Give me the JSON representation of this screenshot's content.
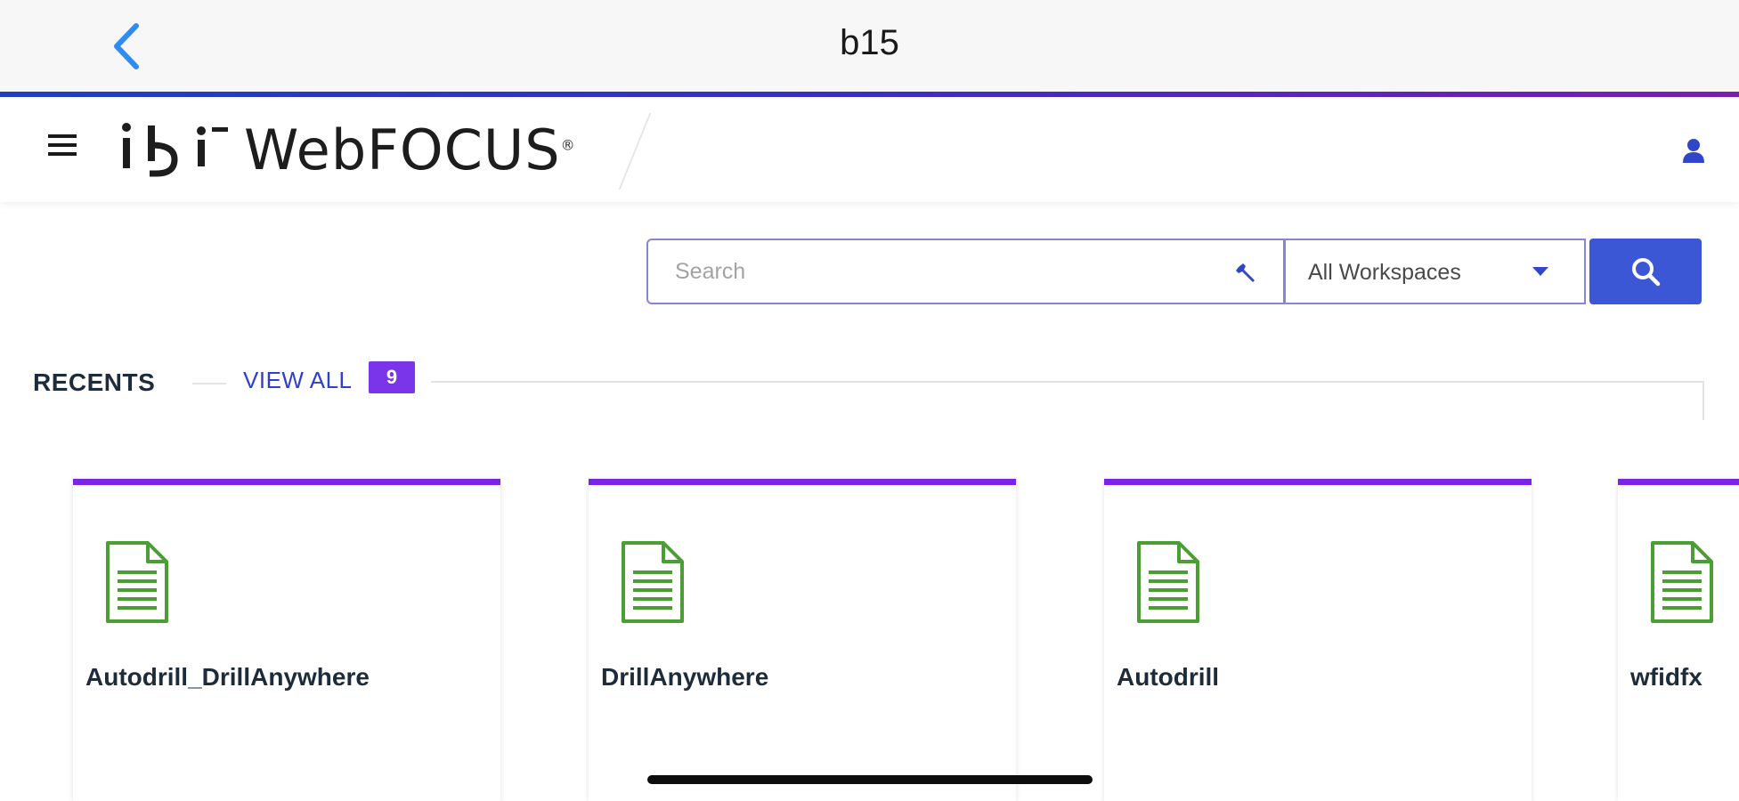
{
  "nav_bar": {
    "title": "b15"
  },
  "header": {
    "brand_name": "WebFOCUS",
    "brand_mark_symbol": "®"
  },
  "search": {
    "placeholder": "Search",
    "scope_selected": "All Workspaces"
  },
  "recents": {
    "title": "RECENTS",
    "view_all_label": "VIEW ALL",
    "count": "9",
    "items": [
      {
        "name": "Autodrill_DrillAnywhere",
        "icon": "document-icon"
      },
      {
        "name": "DrillAnywhere",
        "icon": "document-icon"
      },
      {
        "name": "Autodrill",
        "icon": "document-icon"
      },
      {
        "name": "wfidfx",
        "icon": "document-icon"
      }
    ]
  },
  "colors": {
    "accent_purple": "#7a24e8",
    "badge_purple": "#7a35ea",
    "search_button_blue": "#3b57d6",
    "link_blue": "#2f3fcf",
    "ios_back_blue": "#2f8cf0",
    "file_icon_green": "#4a9e34",
    "header_gradient_start": "#1f3fbf",
    "header_gradient_end": "#7b1fb0"
  },
  "icons": {
    "back": "chevron-left-icon",
    "menu": "hamburger-menu-icon",
    "user": "user-icon",
    "wrench": "wrench-icon",
    "dropdown": "caret-down-icon",
    "search": "search-icon"
  }
}
